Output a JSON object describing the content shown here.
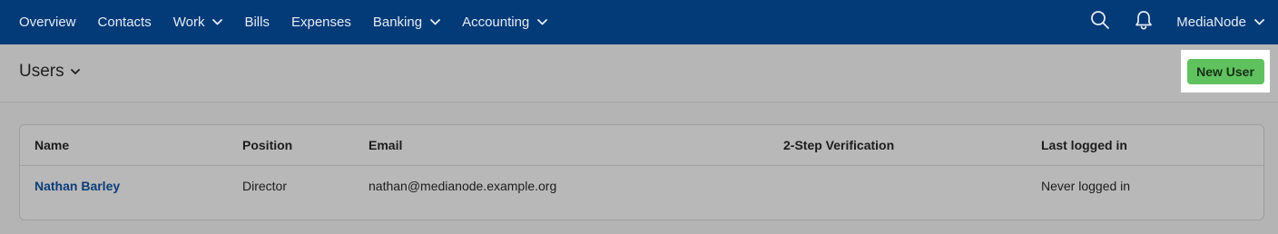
{
  "nav": {
    "items": [
      {
        "label": "Overview",
        "has_dropdown": false
      },
      {
        "label": "Contacts",
        "has_dropdown": false
      },
      {
        "label": "Work",
        "has_dropdown": true
      },
      {
        "label": "Bills",
        "has_dropdown": false
      },
      {
        "label": "Expenses",
        "has_dropdown": false
      },
      {
        "label": "Banking",
        "has_dropdown": true
      },
      {
        "label": "Accounting",
        "has_dropdown": true
      }
    ],
    "search_icon": "search-icon",
    "notifications_icon": "bell-icon",
    "account_label": "MediaNode"
  },
  "page": {
    "title": "Users",
    "new_user_label": "New User"
  },
  "table": {
    "columns": [
      "Name",
      "Position",
      "Email",
      "2-Step Verification",
      "Last logged in"
    ],
    "rows": [
      {
        "name": "Nathan Barley",
        "position": "Director",
        "email": "nathan@medianode.example.org",
        "two_step": "",
        "last_logged_in": "Never logged in"
      }
    ]
  },
  "colors": {
    "nav_bg": "#033a78",
    "primary_button": "#5fc25f",
    "link": "#0b3d7a"
  }
}
